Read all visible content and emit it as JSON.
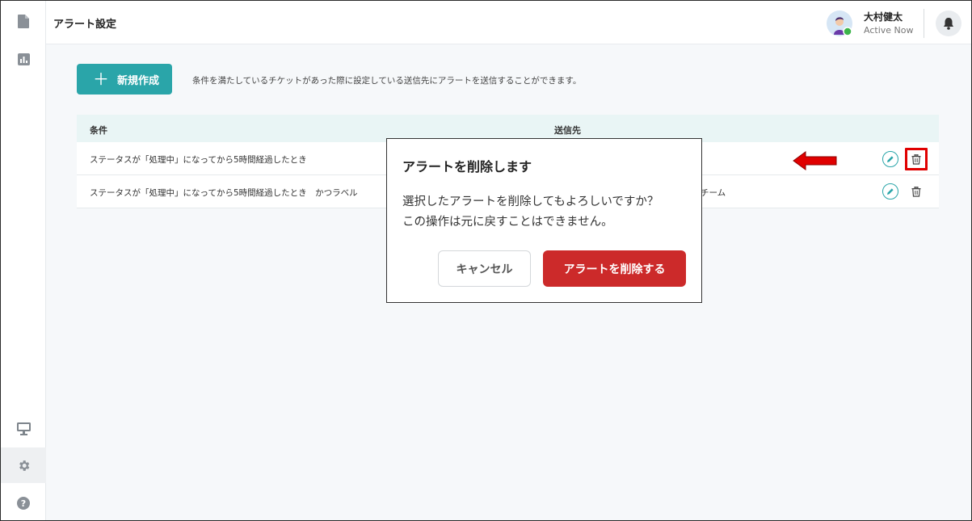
{
  "header": {
    "title": "アラート設定",
    "user_name": "大村健太",
    "user_status": "Active Now"
  },
  "sidebar": {
    "items": [
      {
        "icon": "document-icon"
      },
      {
        "icon": "chart-icon"
      },
      {
        "icon": "monitor-icon"
      },
      {
        "icon": "gear-icon"
      },
      {
        "icon": "help-icon"
      }
    ]
  },
  "toolbar": {
    "new_label": "新規作成",
    "new_plus": "＋",
    "description": "条件を満たしているチケットがあった際に設定している送信先にアラートを送信することができます。"
  },
  "table": {
    "columns": [
      "条件",
      "送信先"
    ],
    "rows": [
      {
        "condition": "ステータスが「処理中」になってから5時間経過したとき",
        "destination": ""
      },
      {
        "condition": "ステータスが「処理中」になってから5時間経過したとき　かつラベル",
        "destination": "チーム"
      }
    ]
  },
  "modal": {
    "title": "アラートを削除します",
    "body_line1": "選択したアラートを削除してもよろしいですか？",
    "body_line2": "この操作は元に戻すことはできません。",
    "cancel_label": "キャンセル",
    "delete_label": "アラートを削除する"
  },
  "colors": {
    "accent": "#2aa5a9",
    "danger": "#cc2a2a",
    "annotation": "#e00000"
  }
}
